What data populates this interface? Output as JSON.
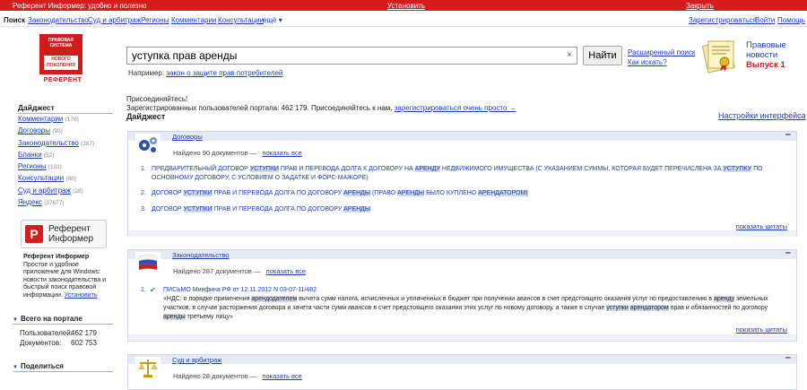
{
  "topbar": {
    "slogan": "Референт Информер: удобно и полезно",
    "install": "Установить",
    "close": "Закрыть"
  },
  "nav": {
    "items": [
      "Поиск",
      "Законодательство",
      "Суд и арбитраж",
      "Регионы",
      "Комментарии",
      "Консультации",
      "ещё ▾"
    ],
    "register": "Зарегистрироваться",
    "login": "Войти",
    "help": "Помощь"
  },
  "logo": {
    "line1": "ПРАВОВАЯ СИСТЕМА",
    "line2": "НОВОГО ПОКОЛЕНИЯ",
    "brand": "РЕФЕРЕНТ"
  },
  "search": {
    "value": "уступка прав аренды",
    "clear": "×",
    "button": "Найти",
    "advanced": "Расширенный поиск",
    "how": "Как искать?",
    "example_label": "Например:",
    "example_link": "закон о защите прав потребителей"
  },
  "promo": {
    "line1": "Правовые",
    "line2": "новости",
    "line3": "Выпуск 1"
  },
  "join": {
    "title": "Присоединяйтесь!",
    "text": "Зарегистрированных пользователей портала: 462 179. Присоединяйтесь к нам,",
    "link": "зарегистрироваться очень просто →"
  },
  "digest": {
    "title": "Дайджест",
    "settings": "Настройки интерфейса"
  },
  "sidebar": {
    "heading": "Дайджест",
    "items": [
      {
        "label": "Комментарии",
        "count": "(176)"
      },
      {
        "label": "Договоры",
        "count": "(90)"
      },
      {
        "label": "Законодательство",
        "count": "(287)"
      },
      {
        "label": "Бланки",
        "count": "(52)"
      },
      {
        "label": "Регионы",
        "count": "(101)"
      },
      {
        "label": "Консультации",
        "count": "(88)"
      },
      {
        "label": "Суд и арбитраж",
        "count": "(28)"
      },
      {
        "label": "Яндекс",
        "count": "(37677)"
      }
    ],
    "informer": {
      "letter": "Р",
      "title1": "Референт",
      "title2": "Информер",
      "desc_title": "Референт Информер",
      "desc": "Простое и удобное приложение для Windows: новости законодательства и быстрый поиск правовой информации.",
      "install": "Установить"
    },
    "portal": {
      "heading": "Всего на портале",
      "users_label": "Пользователей:",
      "users": "462 179",
      "docs_label": "Документов:",
      "docs": "602 753"
    },
    "share": "Поделиться"
  },
  "panels": {
    "contracts": {
      "title": "Договоры",
      "found": "Найдено 90 документов",
      "dash": "—",
      "show_all": "показать все",
      "quotes": "показать цитаты",
      "results": [
        "Предварительный договор уступки прав и перевода долга к договору на аренду недвижимого имущества (с указанием суммы, которая будет перечислена за уступку по основному договору, с условием о задатке и форс-мажоре)",
        "Договор уступки прав и перевода долга по договору аренды (право аренды было куплено арендатором)",
        "Договор уступки прав и перевода долга по договору аренды"
      ]
    },
    "law": {
      "title": "Законодательство",
      "found": "Найдено 287 документов",
      "dash": "—",
      "show_all": "показать все",
      "quotes": "показать цитаты",
      "result_title": "ПИСЬМО Минфина РФ от 12.11.2012 N 03-07-11/482",
      "result_text": "«НДС: о порядке применения арендодателем вычета сумм налога, исчисленных и уплаченных в бюджет при получении авансов в счет предстоящего оказания услуг по предоставлению в аренду земельных участков, в случае расторжения договора и зачета части сумм авансов в счет предстоящего оказания этих услуг по новому договору, а также в случае уступки арендатором прав и обязанностей по договору аренды третьему лицу»"
    },
    "court": {
      "title": "Суд и арбитраж",
      "found": "Найдено 28 документов",
      "dash": "—",
      "show_all": "показать все"
    }
  }
}
